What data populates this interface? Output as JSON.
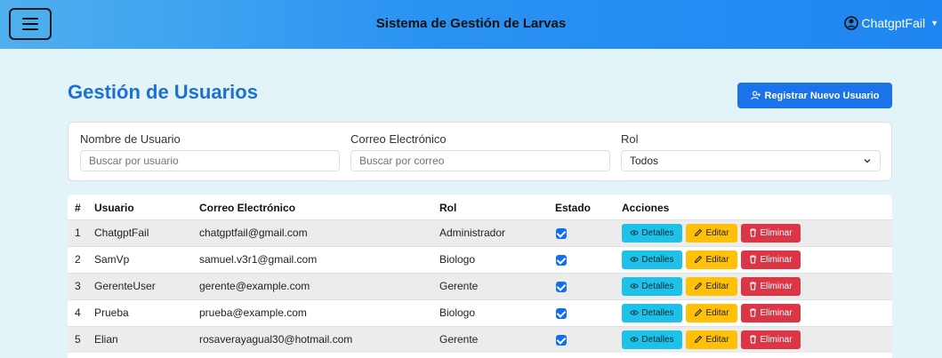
{
  "header": {
    "title": "Sistema de Gestión de Larvas",
    "user": "ChatgptFail",
    "menu_icon": "hamburger-icon",
    "user_icon": "user-circle-icon"
  },
  "page": {
    "title": "Gestión de Usuarios",
    "register_button": "Registrar Nuevo Usuario"
  },
  "filters": {
    "username_label": "Nombre de Usuario",
    "username_placeholder": "Buscar por usuario",
    "email_label": "Correo Electrónico",
    "email_placeholder": "Buscar por correo",
    "role_label": "Rol",
    "role_value": "Todos"
  },
  "table": {
    "headers": [
      "#",
      "Usuario",
      "Correo Electrónico",
      "Rol",
      "Estado",
      "Acciones"
    ],
    "rows": [
      {
        "num": "1",
        "user": "ChatgptFail",
        "email": "chatgptfail@gmail.com",
        "role": "Administrador",
        "active": true
      },
      {
        "num": "2",
        "user": "SamVp",
        "email": "samuel.v3r1@gmail.com",
        "role": "Biologo",
        "active": true
      },
      {
        "num": "3",
        "user": "GerenteUser",
        "email": "gerente@example.com",
        "role": "Gerente",
        "active": true
      },
      {
        "num": "4",
        "user": "Prueba",
        "email": "prueba@example.com",
        "role": "Biologo",
        "active": true
      },
      {
        "num": "5",
        "user": "Elian",
        "email": "rosaverayagual30@hotmail.com",
        "role": "Gerente",
        "active": true
      }
    ],
    "actions": {
      "details": "Detalles",
      "edit": "Editar",
      "delete": "Eliminar"
    }
  },
  "colors": {
    "primary": "#1a73e8",
    "info": "#1ec1e8",
    "warning": "#ffc107",
    "danger": "#dc3545",
    "background": "#e3f4f8"
  }
}
